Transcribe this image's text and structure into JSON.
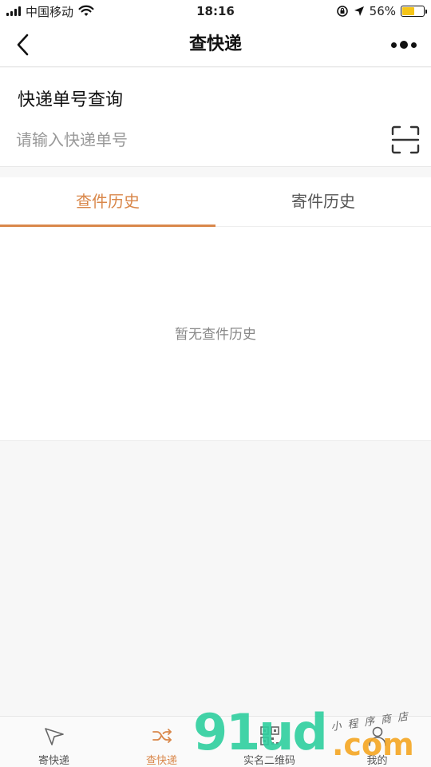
{
  "status_bar": {
    "carrier": "中国移动",
    "time": "18:16",
    "battery": "56%",
    "battery_level": 0.56
  },
  "nav": {
    "title": "查快递"
  },
  "query": {
    "title": "快递单号查询",
    "input_value": "",
    "placeholder": "请输入快递单号"
  },
  "tabs": [
    {
      "label": "查件历史",
      "active": true
    },
    {
      "label": "寄件历史",
      "active": false
    }
  ],
  "empty_state": {
    "text": "暂无查件历史"
  },
  "tab_bar": [
    {
      "label": "寄快递",
      "icon": "paper-plane-icon",
      "active": false
    },
    {
      "label": "查快递",
      "icon": "shuffle-icon",
      "active": true
    },
    {
      "label": "实名二维码",
      "icon": "qr-code-icon",
      "active": false
    },
    {
      "label": "我的",
      "icon": "user-icon",
      "active": false
    }
  ],
  "watermark": {
    "main": "91ud",
    "dotcom": ".com",
    "sub": "小程序商店"
  },
  "colors": {
    "accent": "#d9874a",
    "background": "#f7f7f7"
  }
}
